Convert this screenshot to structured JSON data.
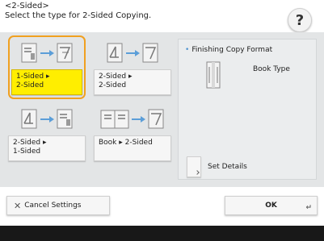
{
  "header": {
    "title": "<2-Sided>",
    "subtitle": "Select the type for 2-Sided Copying."
  },
  "help_label": "?",
  "options": [
    {
      "label_line1": "1-Sided ▸",
      "label_line2": "2-Sided",
      "selected": true
    },
    {
      "label_line1": "2-Sided ▸",
      "label_line2": "2-Sided",
      "selected": false
    },
    {
      "label_line1": "2-Sided ▸",
      "label_line2": "1-Sided",
      "selected": false
    },
    {
      "label_line1": "Book ▸ 2-Sided",
      "label_line2": "",
      "selected": false
    }
  ],
  "finishing": {
    "title": "Finishing Copy Format",
    "type_label": "Book Type"
  },
  "set_details_label": "Set Details",
  "bottom": {
    "cancel_label": "Cancel Settings",
    "ok_label": "OK"
  },
  "colors": {
    "accent_yellow": "#ffee00",
    "selection_border": "#f0a020",
    "arrow_blue": "#5b9ed8"
  }
}
